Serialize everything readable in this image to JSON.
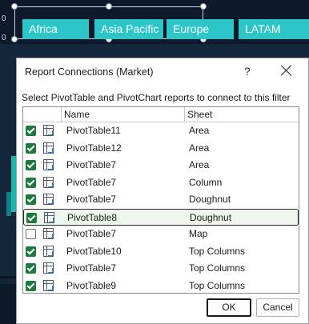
{
  "slicer": {
    "items": [
      {
        "label": "Africa"
      },
      {
        "label": "Asia Pacific"
      },
      {
        "label": "Europe"
      },
      {
        "label": "LATAM"
      }
    ],
    "color": "#2cc6c9"
  },
  "backdrop": {
    "axis_zero_label": "0"
  },
  "dialog": {
    "title": "Report Connections (Market)",
    "help": "?",
    "instruction": "Select PivotTable and PivotChart reports to connect to this filter",
    "columns": {
      "check": "",
      "name": "Name",
      "sheet": "Sheet"
    },
    "rows": [
      {
        "checked": true,
        "name": "PivotTable11",
        "sheet": "Area"
      },
      {
        "checked": true,
        "name": "PivotTable12",
        "sheet": "Area"
      },
      {
        "checked": true,
        "name": "PivotTable7",
        "sheet": "Area"
      },
      {
        "checked": true,
        "name": "PivotTable7",
        "sheet": "Column"
      },
      {
        "checked": true,
        "name": "PivotTable7",
        "sheet": "Doughnut"
      },
      {
        "checked": true,
        "name": "PivotTable8",
        "sheet": "Doughnut",
        "selected": true
      },
      {
        "checked": false,
        "name": "PivotTable7",
        "sheet": "Map"
      },
      {
        "checked": true,
        "name": "PivotTable10",
        "sheet": "Top Columns"
      },
      {
        "checked": true,
        "name": "PivotTable7",
        "sheet": "Top Columns"
      },
      {
        "checked": true,
        "name": "PivotTable9",
        "sheet": "Top Columns"
      }
    ],
    "buttons": {
      "ok": "OK",
      "cancel": "Cancel"
    },
    "check_color": "#1d7a3f"
  }
}
